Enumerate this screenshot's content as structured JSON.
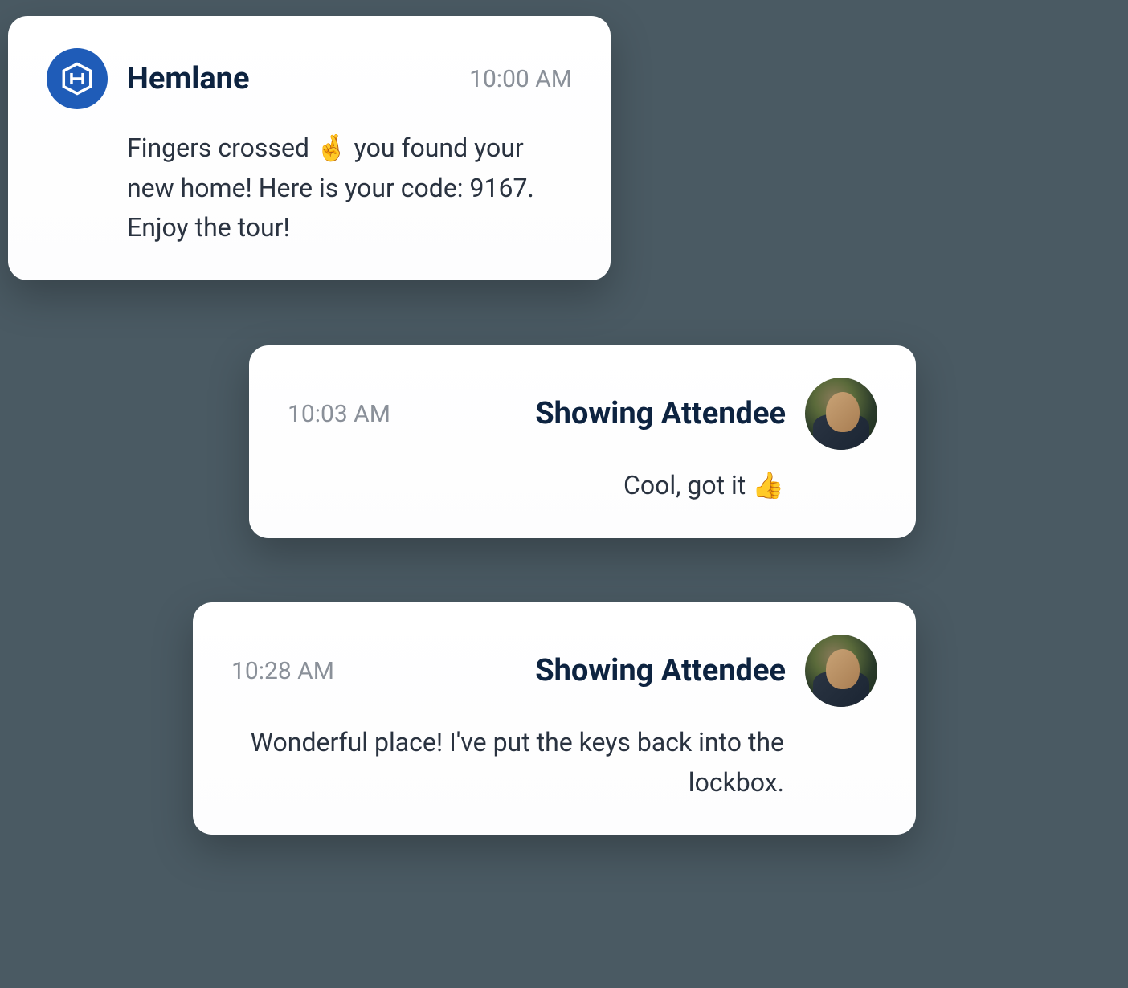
{
  "messages": [
    {
      "sender": "Hemlane",
      "timestamp": "10:00 AM",
      "body": "Fingers crossed 🤞 you found your new home! Here is your code: 9167. Enjoy the tour!",
      "avatar": "hemlane-logo"
    },
    {
      "sender": "Showing Attendee",
      "timestamp": "10:03 AM",
      "body": "Cool, got it 👍",
      "avatar": "attendee-photo"
    },
    {
      "sender": "Showing Attendee",
      "timestamp": "10:28 AM",
      "body": "Wonderful place! I've put the keys back into the lockbox.",
      "avatar": "attendee-photo"
    }
  ],
  "colors": {
    "brand_blue": "#1f5cb8",
    "dark_navy": "#0d2340",
    "text_gray": "#8a9099"
  }
}
